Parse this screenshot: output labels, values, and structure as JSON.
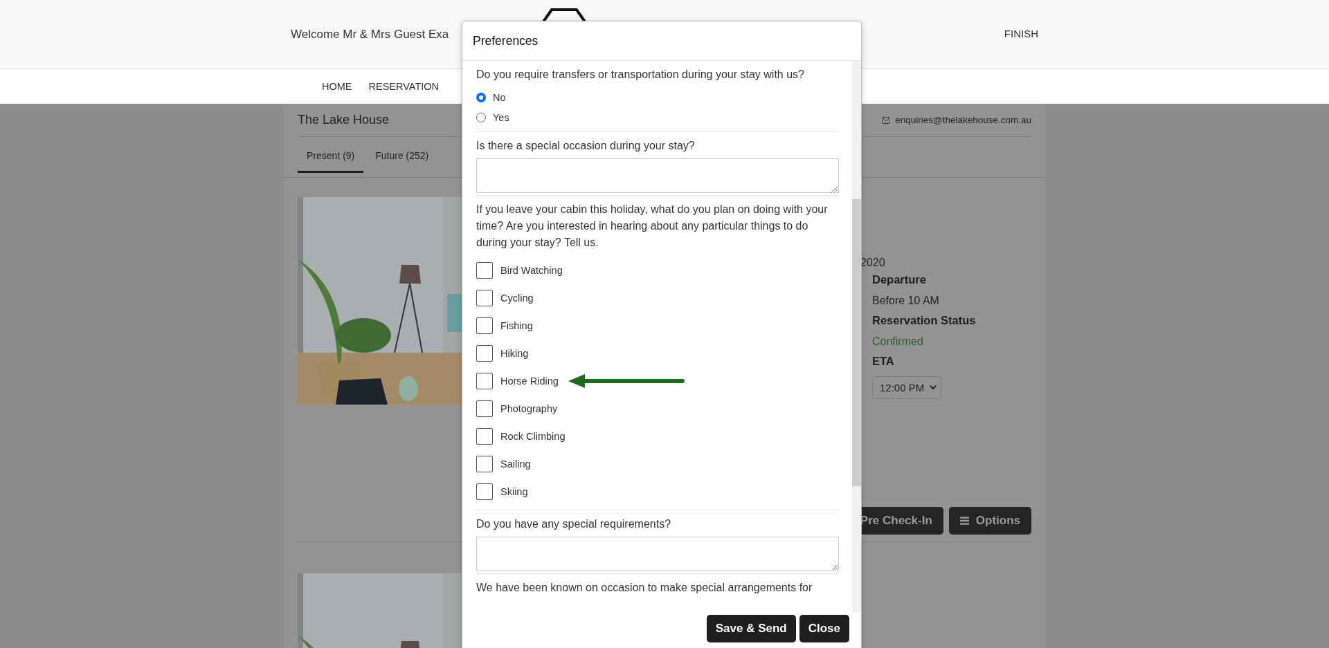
{
  "header": {
    "welcome": "Welcome Mr & Mrs Guest Exa",
    "finish": "FINISH"
  },
  "nav": [
    "HOME",
    "RESERVATION"
  ],
  "property": {
    "name": "The Lake House",
    "email": "enquiries@thelakehouse.com.au"
  },
  "tabs": [
    {
      "label": "Present (9)",
      "selected": true
    },
    {
      "label": "Future (252)",
      "selected": false
    }
  ],
  "details": [
    {
      "kind": "value",
      "text": "2020"
    },
    {
      "kind": "heading",
      "text": "Departure"
    },
    {
      "kind": "value",
      "text": "Before 10 AM"
    },
    {
      "kind": "heading",
      "text": "Reservation Status"
    },
    {
      "kind": "status",
      "text": "Confirmed"
    },
    {
      "kind": "heading",
      "text": "ETA"
    },
    {
      "kind": "select",
      "text": "12:00 PM"
    }
  ],
  "actions": [
    {
      "label": "Pre Check-In",
      "kind": "plain"
    },
    {
      "label": "Options",
      "kind": "menu"
    }
  ],
  "modal": {
    "title": "Preferences",
    "sections": [
      {
        "kind": "radio",
        "question": "Do you require transfers or transportation during your stay with us?",
        "options": [
          {
            "label": "No",
            "selected": true
          },
          {
            "label": "Yes",
            "selected": false
          }
        ]
      },
      {
        "kind": "text",
        "question": "Is there a special occasion during your stay?"
      },
      {
        "kind": "checkboxes",
        "question": "If you leave your cabin this holiday, what do you plan on doing with your time? Are you interested in hearing about any particular things to do during your stay? Tell us.",
        "options": [
          {
            "label": "Bird Watching",
            "checked": false
          },
          {
            "label": "Cycling",
            "checked": false
          },
          {
            "label": "Fishing",
            "checked": false
          },
          {
            "label": "Hiking",
            "checked": false
          },
          {
            "label": "Horse Riding",
            "checked": false,
            "pointer": true
          },
          {
            "label": "Photography",
            "checked": false
          },
          {
            "label": "Rock Climbing",
            "checked": false
          },
          {
            "label": "Sailing",
            "checked": false
          },
          {
            "label": "Skiing",
            "checked": false
          }
        ]
      },
      {
        "kind": "text",
        "question": "Do you have any special requirements?"
      },
      {
        "kind": "note",
        "text": "We have been known on occasion to make special arrangements for"
      }
    ],
    "buttons": [
      "Save & Send",
      "Close"
    ]
  }
}
